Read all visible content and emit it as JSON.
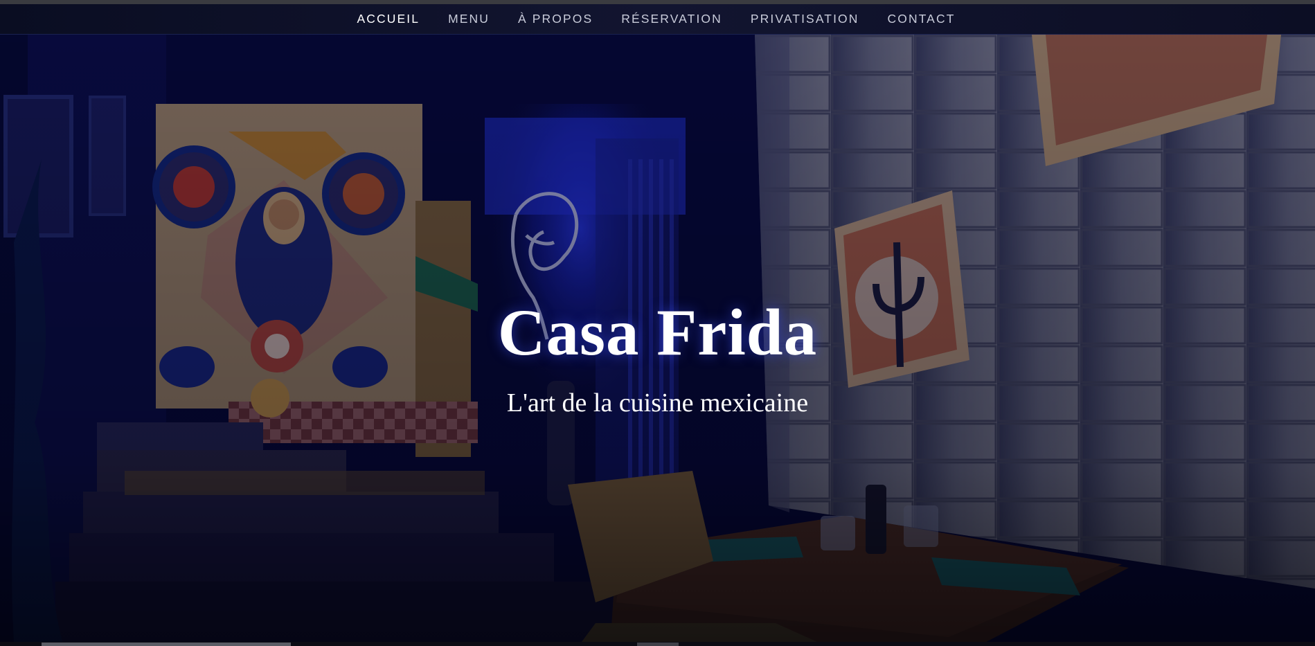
{
  "nav": {
    "items": [
      {
        "label": "ACCUEIL",
        "active": true
      },
      {
        "label": "MENU",
        "active": false
      },
      {
        "label": "À PROPOS",
        "active": false
      },
      {
        "label": "RÉSERVATION",
        "active": false
      },
      {
        "label": "PRIVATISATION",
        "active": false
      },
      {
        "label": "CONTACT",
        "active": false
      }
    ]
  },
  "hero": {
    "title": "Casa Frida",
    "subtitle": "L'art de la cuisine mexicaine",
    "background_icon": "restaurant-interior-photo"
  },
  "colors": {
    "nav_background": "#0f1128",
    "nav_text": "#c9ccda",
    "nav_active": "#ffffff",
    "neon_blue": "#2a3cff",
    "overlay": "#050830"
  }
}
